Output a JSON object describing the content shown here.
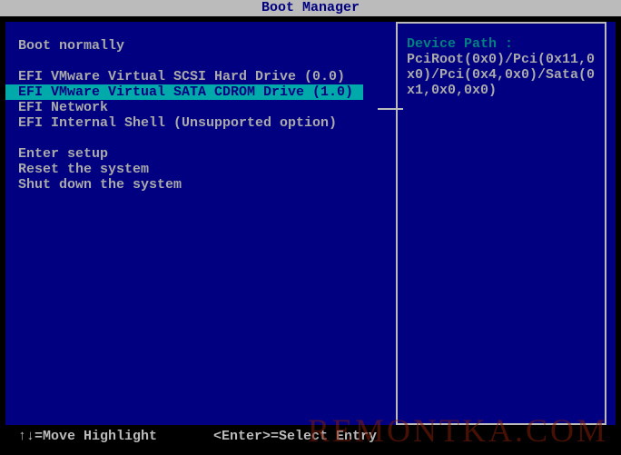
{
  "title": "Boot Manager",
  "menu": {
    "boot_normally": "Boot normally",
    "efi_scsi": "EFI VMware Virtual SCSI Hard Drive (0.0)",
    "efi_sata_cdrom": "EFI VMware Virtual SATA CDROM Drive (1.0)",
    "efi_network": "EFI Network",
    "efi_shell": "EFI Internal Shell (Unsupported option)",
    "enter_setup": "Enter setup",
    "reset_system": "Reset the system",
    "shutdown_system": "Shut down the system"
  },
  "detail": {
    "device_path_label": "Device Path :",
    "device_path_value": "PciRoot(0x0)/Pci(0x11,0x0)/Pci(0x4,0x0)/Sata(0x1,0x0,0x0)"
  },
  "footer": {
    "move_highlight": "↑↓=Move Highlight",
    "select_entry": "<Enter>=Select Entry"
  },
  "watermark": "REMONTKA.COM"
}
